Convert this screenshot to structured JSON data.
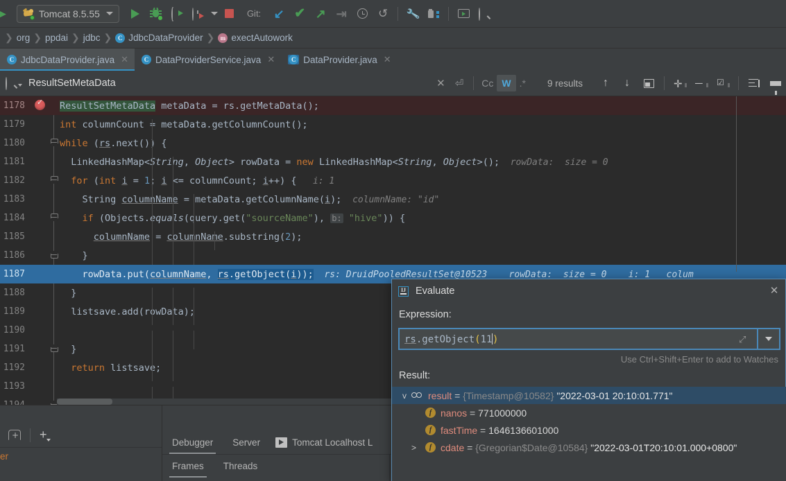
{
  "toolbar": {
    "run_config_label": "Tomcat 8.5.55",
    "git_label": "Git:",
    "icons": [
      "cat-icon",
      "run-icon",
      "debug-icon",
      "attach-debugger-icon",
      "run-with-coverage-icon",
      "stop-icon",
      "git-update-icon",
      "git-commit-icon",
      "git-push-icon",
      "git-rollback-icon",
      "git-history-icon",
      "undo-icon",
      "settings-wrench-icon",
      "project-structure-icon",
      "terminal-icon",
      "search-everywhere-icon"
    ]
  },
  "breadcrumb": {
    "items": [
      {
        "label": "org",
        "icon": ""
      },
      {
        "label": "ppdai",
        "icon": ""
      },
      {
        "label": "jdbc",
        "icon": ""
      },
      {
        "label": "JdbcDataProvider",
        "icon": "C"
      },
      {
        "label": "exectAutowork",
        "icon": "m"
      }
    ]
  },
  "tabs": [
    {
      "label": "JdbcDataProvider.java",
      "icon": "C",
      "active": true
    },
    {
      "label": "DataProviderService.java",
      "icon": "C",
      "active": false
    },
    {
      "label": "DataProvider.java",
      "icon": "C",
      "active": false
    }
  ],
  "findbar": {
    "query": "ResultSetMetaData",
    "results_text": "9 results",
    "match_case_label": "Cc",
    "words_label": "W",
    "regex_label": ".*",
    "words_active": true,
    "accent": "#4fa7d8"
  },
  "editor": {
    "lines": [
      {
        "num": "1178",
        "indent": 0
      },
      {
        "num": "1179",
        "indent": 0
      },
      {
        "num": "1180",
        "indent": 0
      },
      {
        "num": "1181",
        "indent": 0
      },
      {
        "num": "1182",
        "indent": 0
      },
      {
        "num": "1183",
        "indent": 0
      },
      {
        "num": "1184",
        "indent": 0
      },
      {
        "num": "1185",
        "indent": 0
      },
      {
        "num": "1186",
        "indent": 0
      },
      {
        "num": "1187",
        "indent": 0
      },
      {
        "num": "1188",
        "indent": 0
      },
      {
        "num": "1189",
        "indent": 0
      },
      {
        "num": "1190",
        "indent": 0
      },
      {
        "num": "1191",
        "indent": 0
      },
      {
        "num": "1192",
        "indent": 0
      },
      {
        "num": "1193",
        "indent": 0
      },
      {
        "num": "1194",
        "indent": 0
      }
    ],
    "code": {
      "l1178_match": "ResultSetMetaData",
      "l1178_rest": " metaData = rs.getMetaData();",
      "l1179": "int columnCount = metaData.getColumnCount();",
      "l1180": "while (rs.next()) {",
      "l1181": "LinkedHashMap<String, Object> rowData = new LinkedHashMap<String, Object>();",
      "l1181_hint": "rowData:  size = 0",
      "l1182": "for (int i = 1; i <= columnCount; i++) {",
      "l1182_hint": "i: 1",
      "l1183": "String columnName = metaData.getColumnName(i);",
      "l1183_hint": "columnName: \"id\"",
      "l1184_a": "if (Objects.equals(query.get(\"sourceName\"), ",
      "l1184_tag": "b:",
      "l1184_b": " \"hive\")) {",
      "l1185": "columnName = columnName.substring(2);",
      "l1186": "}",
      "l1187_a": "rowData.put(columnName, ",
      "l1187_sel": "rs.getObject(i));",
      "l1187_hint1": "rs: DruidPooledResultSet@10523",
      "l1187_hint2": "rowData:  size = 0",
      "l1187_hint3": "i: 1",
      "l1187_hint4": "colum",
      "l1188": "}",
      "l1189": "listsave.add(rowData);",
      "l1191": "}",
      "l1192": "return listsave;",
      "l1194": "}"
    }
  },
  "evaluate": {
    "title": "Evaluate",
    "expression_label": "Expression:",
    "expression_value": "rs.getObject(11)",
    "expr_prefix": "rs.getObject",
    "expr_open": "(",
    "expr_arg": "11",
    "expr_close": ")",
    "watch_hint": "Use Ctrl+Shift+Enter to add to Watches",
    "result_label": "Result:",
    "rows": [
      {
        "arrow": "v",
        "icon": "watch-glasses-icon",
        "name": "result",
        "eq": " = ",
        "type": "{Timestamp@10582}",
        "value": "\"2022-03-01 20:10:01.771\"",
        "selected": true,
        "depth": 0
      },
      {
        "arrow": "",
        "icon": "field-icon",
        "name": "nanos",
        "eq": " = ",
        "type": "",
        "value": "771000000",
        "selected": false,
        "depth": 1
      },
      {
        "arrow": "",
        "icon": "field-icon",
        "name": "fastTime",
        "eq": " = ",
        "type": "",
        "value": "1646136601000",
        "selected": false,
        "depth": 1
      },
      {
        "arrow": ">",
        "icon": "field-icon",
        "name": "cdate",
        "eq": " = ",
        "type": "{Gregorian$Date@10584}",
        "value": "\"2022-03-01T20:10:01.000+0800\"",
        "selected": false,
        "depth": 1
      }
    ]
  },
  "bottom": {
    "left_truncated_text": "er",
    "tabs": [
      {
        "label": "Debugger",
        "active": true
      },
      {
        "label": "Server",
        "active": false
      }
    ],
    "run_tab_label": "Tomcat Localhost L",
    "subtabs": [
      {
        "label": "Frames",
        "active": true
      },
      {
        "label": "Threads",
        "active": false
      }
    ]
  }
}
